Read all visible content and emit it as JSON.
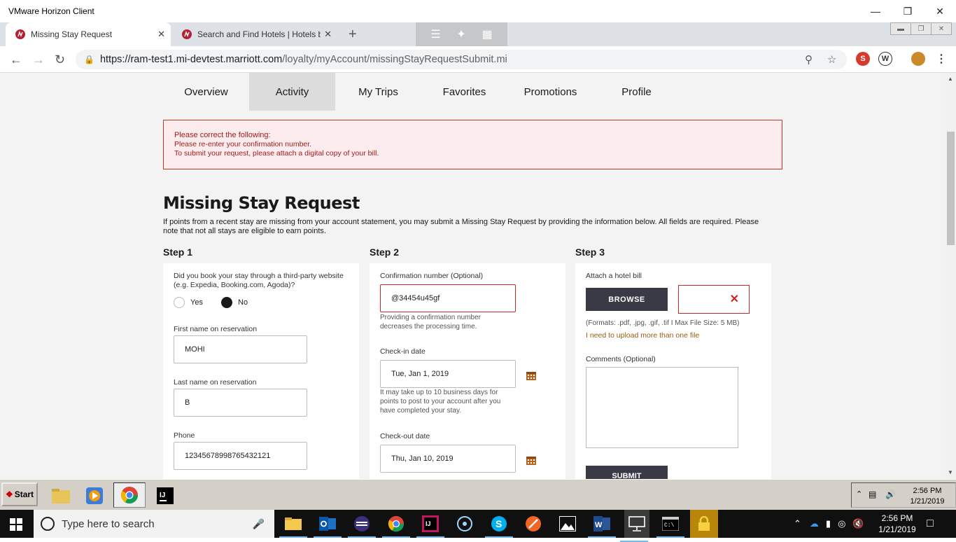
{
  "window": {
    "title": "VMware Horizon Client"
  },
  "tabs": [
    {
      "label": "Missing Stay Request",
      "active": true
    },
    {
      "label": "Search and Find Hotels | Hotels by M",
      "active": false
    }
  ],
  "address": {
    "url_host": "https://ram-test1.mi-devtest.marriott.com",
    "url_path": "/loyalty/myAccount/missingStayRequestSubmit.mi"
  },
  "subnav": [
    "Overview",
    "Activity",
    "My Trips",
    "Favorites",
    "Promotions",
    "Profile"
  ],
  "error": {
    "heading": "Please correct the following:",
    "lines": [
      "Please re-enter your confirmation number.",
      "To submit your request, please attach a digital copy of your bill."
    ]
  },
  "page_title": "Missing Stay Request",
  "intro": "If points from a recent stay are missing from your account statement, you may submit a Missing Stay Request by providing the information below. All fields are required. Please note that not all stays are eligible to earn points.",
  "step1": {
    "label": "Step 1",
    "question": "Did you book your stay through a third-party website (e.g. Expedia, Booking.com, Agoda)?",
    "yes": "Yes",
    "no": "No",
    "selected": "No",
    "first_name_label": "First name on reservation",
    "first_name": "MOHI",
    "last_name_label": "Last name on reservation",
    "last_name": "B",
    "phone_label": "Phone",
    "phone": "12345678998765432121"
  },
  "step2": {
    "label": "Step 2",
    "confirmation_label": "Confirmation number (Optional)",
    "confirmation": "@34454u45gf",
    "confirmation_help": "Providing a confirmation number decreases the processing time.",
    "checkin_label": "Check-in date",
    "checkin": "Tue, Jan 1, 2019",
    "checkin_help": "It may take up to 10 business days for points to post to your account after you have completed your stay.",
    "checkout_label": "Check-out date",
    "checkout": "Thu, Jan 10, 2019"
  },
  "step3": {
    "label": "Step 3",
    "attach_label": "Attach a hotel bill",
    "browse": "BROWSE",
    "formats": "(Formats: .pdf, .jpg, .gif, .tif I Max File Size: 5 MB)",
    "more_files": "I need to upload more than one file",
    "comments_label": "Comments (Optional)",
    "submit": "SUBMIT"
  },
  "vm_taskbar": {
    "start": "Start",
    "time": "2:56 PM",
    "date": "1/21/2019"
  },
  "win_taskbar": {
    "search_placeholder": "Type here to search",
    "time": "2:56 PM",
    "date": "1/21/2019"
  },
  "colors": {
    "marriott_red": "#b22234",
    "error_red": "#c62828",
    "button_dark": "#3a3946",
    "link_brown": "#9a5b10"
  }
}
